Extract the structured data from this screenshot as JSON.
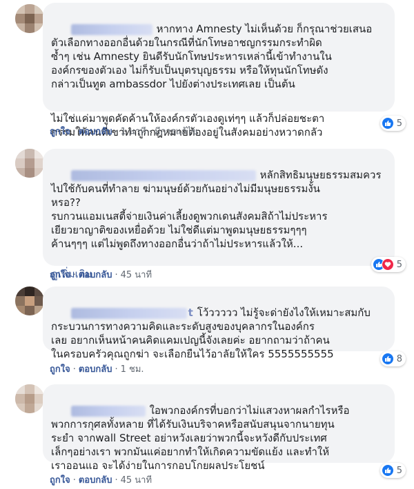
{
  "colors": {
    "link": "#385898",
    "bubble": "#f2f3f5",
    "like": "#1877f2",
    "love": "#f0284a"
  },
  "comments": [
    {
      "name_visible": "",
      "text_paragraphs": [
        "หากทาง Amnesty ไม่เห็นด้วย ก็กรุณาช่วยเสนอ\nตัวเลือกทางออกอื่นด้วยในกรณีที่นักโทษอาชญกรรมกระทำผิด\nซ้ำๆ เช่น Amnesty ยินดีรับนักโทษประหารเหล่านี้เข้าทำงานใน\nองค์กรของตัวเอง ไม่ก็รับเป็นบุตรบุญธรรม หรือให้ทุนนักโทษดัง\nกล่าวเป็นทูต ambassdor ไปยังต่างประเทศเลย เป็นต้น",
        "ไม่ใช่แค่มาพูดคัดค้านให้องค์กรตัวเองดูเท่ๆๆ แล้วก็ปล่อยชะตา\nกรรมให้คนที่เขาทำถูกกฎหมายต้องอยู่ในสังคมอย่างหวาดกลัว"
      ],
      "see_more": "",
      "like": "ถูกใจ",
      "reply": "ตอบกลับ",
      "time": "1 นาที",
      "edited": "มีการแก้ไข",
      "reaction_count": "5",
      "reactions": [
        "like"
      ]
    },
    {
      "name_visible": "",
      "text_paragraphs": [
        "หลักสิทธิมนุษยธรรมสมควร\nไปใช้กับคนที่ทำลาย ฆ่ามนุษย์ด้วยกันอย่างไม่มีมนุษยธรรมงั้น\nหรอ??\nรบกวนแอมเนสตี้จ่ายเงินค่าเลี้ยงดูพวกเดนสังคมสิถ้าไม่ประหาร\nเยียวยาญาติของเหยื่อด้วย ไม่ใช่ดีแต่มาพูดมนุษยธรรมๆๆๆ\nค้านๆๆๆ แต่ไม่พูดถึงทางออกอื่นว่าถ้าไม่ประหารแล้วให้..."
      ],
      "see_more": "ดูเพิ่มเติม",
      "like": "ถูกใจ",
      "reply": "ตอบกลับ",
      "time": "45 นาที",
      "edited": "",
      "reaction_count": "5",
      "reactions": [
        "like",
        "love"
      ]
    },
    {
      "name_visible": "t",
      "text_paragraphs": [
        "โว้ววววว ไม่รู้จะด่ายังไงให้เหมาะสมกับ\nกระบวนการทางความคิดและระดับสูงของบุคลากรในองค์กร\nเลย อยากเห็นหน้าคนคิดแคมเปญนี้จังเลยค่ะ อยากถามว่าถ้าคน\nในครอบครัวคุณถูกฆ่า จะเลือกยืนไว้อาลัยให้ใคร 5555555555"
      ],
      "see_more": "",
      "like": "ถูกใจ",
      "reply": "ตอบกลับ",
      "time": "1 ชม.",
      "edited": "",
      "reaction_count": "8",
      "reactions": [
        "like"
      ]
    },
    {
      "name_visible": "",
      "text_paragraphs": [
        "ใอพวกองค์กรที่บอกว่าไม่แสวงหาผลกำไรหรือ\nพวกการกุศลทั้งหลาย ที่ได้รับเงินบริจาคหรือสนับสนุนจากนายทุน\nระยำ จากwall Street อย่าหวังเลยว่าพวกนี้จะหวังดีกับประเทศ\nเล็กๆอย่างเรา พวกมันแค่อยากทำให้เกิดความขัดแย้ง และทำให้\nเราออนแอ จะได้ง่ายในการกอบโกยผลประโยชน์"
      ],
      "see_more": "",
      "like": "ถูกใจ",
      "reply": "ตอบกลับ",
      "time": "45 นาที",
      "edited": "",
      "reaction_count": "5",
      "reactions": [
        "like"
      ]
    }
  ]
}
